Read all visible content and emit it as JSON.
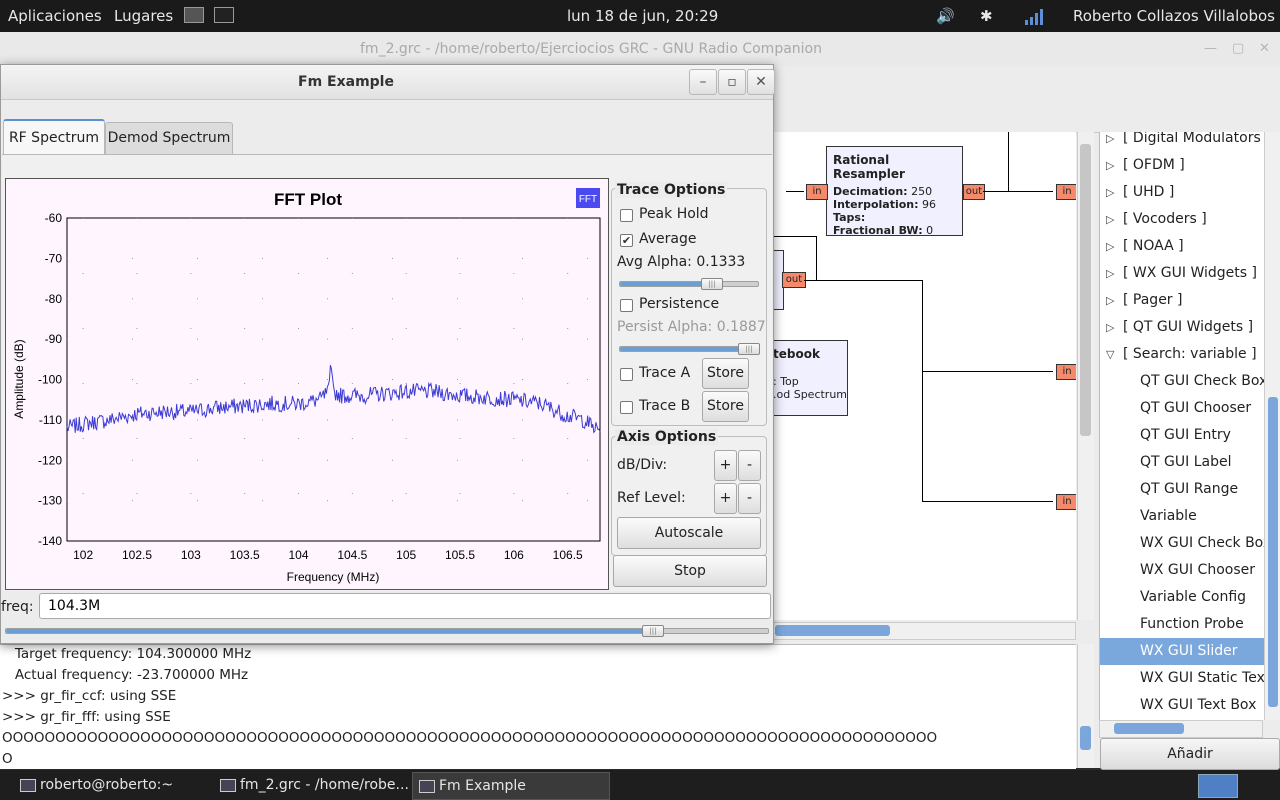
{
  "top_panel": {
    "applications": "Aplicaciones",
    "places": "Lugares",
    "clock": "lun 18 de jun, 20:29",
    "user": "Roberto Collazos Villalobos"
  },
  "grc_window": {
    "title": "fm_2.grc - /home/roberto/Ejerciocios GRC - GNU Radio Companion",
    "canvas": {
      "resampler": {
        "title": "Rational Resampler",
        "params": [
          {
            "k": "Decimation:",
            "v": "250"
          },
          {
            "k": "Interpolation:",
            "v": "96"
          },
          {
            "k": "Taps:",
            "v": ""
          },
          {
            "k": "Fractional BW:",
            "v": "0"
          }
        ],
        "in_port": "in",
        "out_port": "out"
      },
      "notebook": {
        "title": "tebook",
        "line1": ": Top",
        "line2": ".od Spectrum"
      },
      "left_out_port": "out",
      "right_in_port": "in"
    },
    "tree": {
      "items": [
        {
          "label": "[ Digital Modulators ]",
          "arrow": "▷",
          "child": false,
          "selected": false
        },
        {
          "label": "[ OFDM ]",
          "arrow": "▷",
          "child": false,
          "selected": false
        },
        {
          "label": "[ UHD ]",
          "arrow": "▷",
          "child": false,
          "selected": false
        },
        {
          "label": "[ Vocoders ]",
          "arrow": "▷",
          "child": false,
          "selected": false
        },
        {
          "label": "[ NOAA ]",
          "arrow": "▷",
          "child": false,
          "selected": false
        },
        {
          "label": "[ WX GUI Widgets ]",
          "arrow": "▷",
          "child": false,
          "selected": false
        },
        {
          "label": "[ Pager ]",
          "arrow": "▷",
          "child": false,
          "selected": false
        },
        {
          "label": "[ QT GUI Widgets ]",
          "arrow": "▷",
          "child": false,
          "selected": false
        },
        {
          "label": "[ Search: variable ]",
          "arrow": "▽",
          "child": false,
          "selected": false
        },
        {
          "label": "QT GUI Check Box",
          "arrow": "",
          "child": true,
          "selected": false
        },
        {
          "label": "QT GUI Chooser",
          "arrow": "",
          "child": true,
          "selected": false
        },
        {
          "label": "QT GUI Entry",
          "arrow": "",
          "child": true,
          "selected": false
        },
        {
          "label": "QT GUI Label",
          "arrow": "",
          "child": true,
          "selected": false
        },
        {
          "label": "QT GUI Range",
          "arrow": "",
          "child": true,
          "selected": false
        },
        {
          "label": "Variable",
          "arrow": "",
          "child": true,
          "selected": false
        },
        {
          "label": "WX GUI Check Box",
          "arrow": "",
          "child": true,
          "selected": false
        },
        {
          "label": "WX GUI Chooser",
          "arrow": "",
          "child": true,
          "selected": false
        },
        {
          "label": "Variable Config",
          "arrow": "",
          "child": true,
          "selected": false
        },
        {
          "label": "Function Probe",
          "arrow": "",
          "child": true,
          "selected": false
        },
        {
          "label": "WX GUI Slider",
          "arrow": "",
          "child": true,
          "selected": true
        },
        {
          "label": "WX GUI Static Text",
          "arrow": "",
          "child": true,
          "selected": false
        },
        {
          "label": "WX GUI Text Box",
          "arrow": "",
          "child": true,
          "selected": false
        }
      ],
      "add_button": "Añadir"
    },
    "console": [
      "   Target frequency: 104.300000 MHz",
      "   Actual frequency: -23.700000 MHz",
      ">>> gr_fir_ccf: using SSE",
      ">>> gr_fir_fff: using SSE",
      "OOOOOOOOOOOOOOOOOOOOOOOOOOOOOOOOOOOOOOOOOOOOOOOOOOOOOOOOOOOOOOOOOOOOOOOOOOOOOOOOOOOOOOOO",
      "O"
    ]
  },
  "fm_window": {
    "title": "Fm Example",
    "tabs": [
      "RF Spectrum",
      "Demod Spectrum"
    ],
    "active_tab": 0,
    "plot_badge": "FFT",
    "trace_options": {
      "title": "Trace Options",
      "peak_hold": "Peak Hold",
      "peak_hold_checked": false,
      "average": "Average",
      "average_checked": true,
      "avg_alpha": "Avg Alpha: 0.1333",
      "avg_alpha_value": 0.1333,
      "persistence": "Persistence",
      "persistence_checked": false,
      "persist_alpha": "Persist Alpha: 0.1887",
      "persist_alpha_value": 0.1887,
      "trace_a": "Trace A",
      "trace_b": "Trace B",
      "store": "Store"
    },
    "axis_options": {
      "title": "Axis Options",
      "db_div": "dB/Div:",
      "ref_level": "Ref Level:",
      "plus": "+",
      "minus": "-",
      "autoscale": "Autoscale"
    },
    "stop": "Stop",
    "freq_label": "freq:",
    "freq_value": "104.3M",
    "freq_slider_fraction": 0.85
  },
  "taskbar": [
    {
      "label": "roberto@roberto:~",
      "active": false
    },
    {
      "label": "fm_2.grc - /home/robe...",
      "active": false
    },
    {
      "label": "Fm Example",
      "active": true
    }
  ],
  "chart_data": {
    "type": "line",
    "title": "FFT Plot",
    "xlabel": "Frequency (MHz)",
    "ylabel": "Amplitude (dB)",
    "xlim": [
      101.85,
      106.8
    ],
    "ylim": [
      -140,
      -60
    ],
    "xticks": [
      "102",
      "102.5",
      "103",
      "103.5",
      "104",
      "104.5",
      "105",
      "105.5",
      "106",
      "106.5"
    ],
    "yticks": [
      "-60",
      "-70",
      "-80",
      "-90",
      "-100",
      "-110",
      "-120",
      "-130",
      "-140"
    ],
    "grid": true,
    "color": "#3b3bd4",
    "series": [
      {
        "x": [
          101.85,
          102.0,
          102.25,
          102.5,
          102.75,
          103.0,
          103.25,
          103.5,
          103.75,
          104.0,
          104.2,
          104.28,
          104.3,
          104.32,
          104.4,
          104.6,
          104.8,
          105.0,
          105.25,
          105.5,
          105.75,
          106.0,
          106.25,
          106.5,
          106.65,
          106.8
        ],
        "values": [
          -112,
          -111,
          -110,
          -108.5,
          -108,
          -108,
          -107,
          -106.5,
          -106,
          -106,
          -105,
          -103,
          -95,
          -103,
          -104,
          -104,
          -103.5,
          -103,
          -103,
          -104,
          -104.5,
          -105,
          -106,
          -109,
          -110,
          -113
        ]
      }
    ]
  }
}
